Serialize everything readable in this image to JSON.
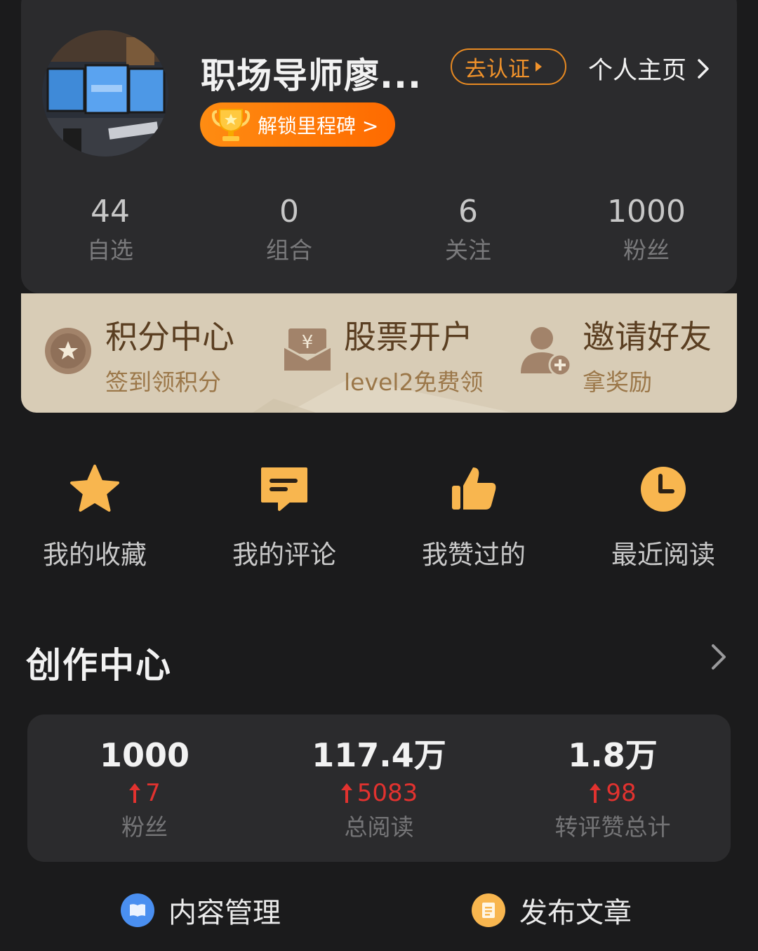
{
  "profile": {
    "name": "职场导师廖...",
    "verify_label": "去认证",
    "homepage_label": "个人主页",
    "milestone_label": "解锁里程碑 >",
    "stats": [
      {
        "value": "44",
        "label": "自选"
      },
      {
        "value": "0",
        "label": "组合"
      },
      {
        "value": "6",
        "label": "关注"
      },
      {
        "value": "1000",
        "label": "粉丝"
      }
    ]
  },
  "benefits": [
    {
      "title": "积分中心",
      "subtitle": "签到领积分",
      "icon": "star-badge-icon"
    },
    {
      "title": "股票开户",
      "subtitle": "level2免费领",
      "icon": "yen-box-icon"
    },
    {
      "title": "邀请好友",
      "subtitle": "拿奖励",
      "icon": "add-user-icon"
    }
  ],
  "quick_actions": [
    {
      "label": "我的收藏",
      "icon": "star-icon"
    },
    {
      "label": "我的评论",
      "icon": "comment-icon"
    },
    {
      "label": "我赞过的",
      "icon": "thumbs-up-icon"
    },
    {
      "label": "最近阅读",
      "icon": "clock-icon"
    }
  ],
  "creator_center": {
    "title": "创作中心",
    "stats": [
      {
        "value": "1000",
        "delta": "7",
        "label": "粉丝"
      },
      {
        "value": "117.4万",
        "delta": "5083",
        "label": "总阅读"
      },
      {
        "value": "1.8万",
        "delta": "98",
        "label": "转评赞总计"
      }
    ]
  },
  "bottom_actions": [
    {
      "label": "内容管理",
      "icon": "content-manage-icon"
    },
    {
      "label": "发布文章",
      "icon": "publish-article-icon"
    }
  ],
  "colors": {
    "background": "#1b1b1c",
    "card": "#2b2b2d",
    "accent_orange": "#f0922b",
    "benefit_bg": "#d8ccb6",
    "delta_red": "#e2322f",
    "icon_yellow": "#f8b64f"
  }
}
